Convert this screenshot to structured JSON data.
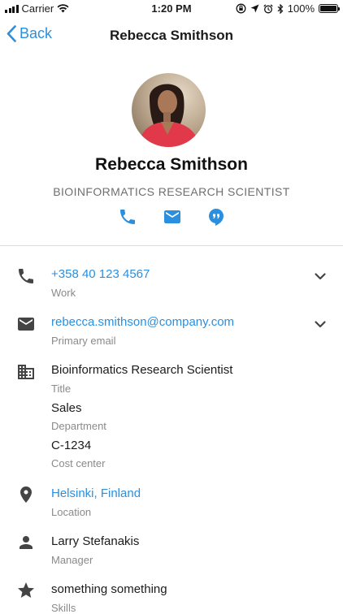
{
  "status_bar": {
    "carrier": "Carrier",
    "time": "1:20 PM",
    "battery": "100%",
    "battery_level": 1.0,
    "icons": [
      "signal-icon",
      "wifi-icon",
      "lock-rotation-icon",
      "location-icon",
      "alarm-icon",
      "bluetooth-icon",
      "battery-icon"
    ]
  },
  "nav": {
    "back_label": "Back",
    "title": "Rebecca Smithson"
  },
  "profile": {
    "name": "Rebecca Smithson",
    "job_title": "BIOINFORMATICS RESEARCH SCIENTIST",
    "actions": [
      "phone-icon",
      "email-icon",
      "chat-bubble-icon"
    ]
  },
  "details": {
    "phone": {
      "value": "+358 40 123 4567",
      "label": "Work"
    },
    "email": {
      "value": "rebecca.smithson@company.com",
      "label": "Primary email"
    },
    "title": {
      "value": "Bioinformatics Research Scientist",
      "label": "Title"
    },
    "department": {
      "value": "Sales",
      "label": "Department"
    },
    "cost_center": {
      "value": "C-1234",
      "label": "Cost center"
    },
    "location": {
      "value": "Helsinki, Finland",
      "label": "Location"
    },
    "manager": {
      "value": "Larry Stefanakis",
      "label": "Manager"
    },
    "skills": {
      "value": "something something",
      "label": "Skills"
    }
  },
  "colors": {
    "accent": "#2b8fe0",
    "text": "#1b1b1b",
    "secondary": "#8a8a8a",
    "icon": "#444444"
  }
}
